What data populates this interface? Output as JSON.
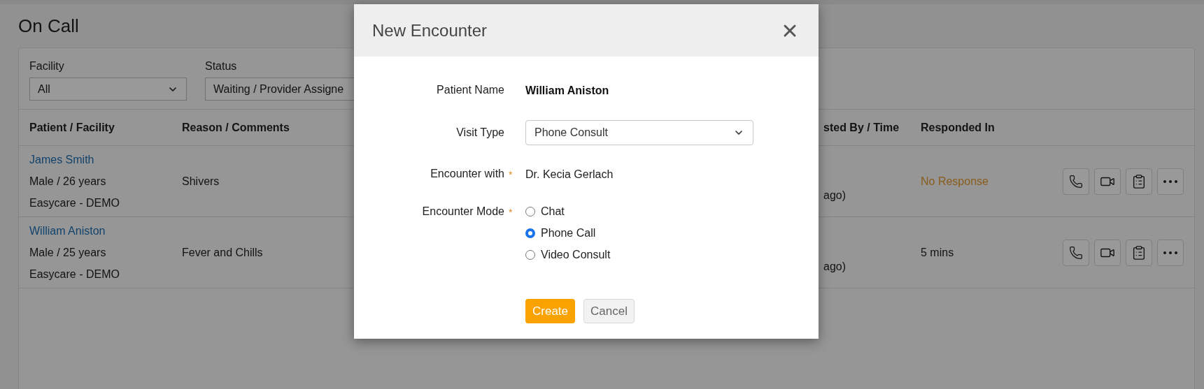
{
  "page": {
    "title": "On Call"
  },
  "filters": [
    {
      "label": "Facility",
      "value": "All",
      "chevron": true
    },
    {
      "label": "Status",
      "value": "Waiting / Provider Assigne"
    }
  ],
  "table": {
    "columns": [
      "Patient / Facility",
      "Reason / Comments",
      "sted By / Time",
      "Responded In"
    ],
    "rows": [
      {
        "patient": "James Smith",
        "demographics": "Male / 26 years",
        "facility": "Easycare - DEMO",
        "reason": "Shivers",
        "requested": "ago)",
        "responded": {
          "text": "No Response",
          "kind": "warning"
        }
      },
      {
        "patient": "William Aniston",
        "demographics": "Male / 25 years",
        "facility": "Easycare - DEMO",
        "reason": "Fever and Chills",
        "requested": "ago)",
        "responded": {
          "text": "5 mins",
          "kind": "normal"
        }
      }
    ]
  },
  "dialog": {
    "title": "New Encounter",
    "fields": [
      {
        "kind": "strong",
        "label": "Patient Name",
        "value": "William Aniston"
      },
      {
        "kind": "select",
        "label": "Visit Type",
        "value": "Phone Consult"
      },
      {
        "kind": "text",
        "label": "Encounter with",
        "required_mark": "*",
        "value": "Dr. Kecia Gerlach"
      },
      {
        "kind": "radio",
        "label": "Encounter Mode",
        "required_mark": "*",
        "options": [
          {
            "label": "Chat",
            "selected": false
          },
          {
            "label": "Phone Call",
            "selected": true
          },
          {
            "label": "Video Consult",
            "selected": false
          }
        ]
      }
    ],
    "buttons": [
      {
        "label": "Create",
        "kind": "primary"
      },
      {
        "label": "Cancel",
        "kind": "secondary"
      }
    ]
  }
}
